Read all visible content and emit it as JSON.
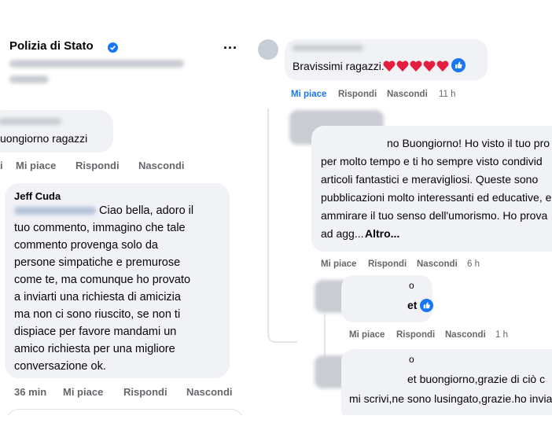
{
  "left": {
    "page_name": "Polizia di Stato",
    "dots_label": "...",
    "first_comment": {
      "text": "uongiorno ragazzi",
      "actions": [
        "Mi piace",
        "Rispondi",
        "Nascondi"
      ],
      "leading_char": "i"
    },
    "reply": {
      "author": "Jeff Cuda",
      "lines": [
        "Ciao bella, adoro il",
        "tuo commento, immagino che tale",
        "commento provenga solo da",
        "persone simpatiche e premurose",
        "come te, ma comunque ho provato",
        "a inviarti una richiesta di amicizia",
        "ma non ci sono riuscito, se non ti",
        "dispiace per favore mandami un",
        "amico  richiesta per una migliore",
        "conversazione ok."
      ],
      "time": "36 min",
      "actions": [
        "Mi piace",
        "Rispondi",
        "Nascondi"
      ]
    }
  },
  "right": {
    "top_comment": {
      "text": "Bravissimi ragazzi.",
      "hearts_count": 5,
      "actions": [
        "Mi piace",
        "Rispondi",
        "Nascondi"
      ],
      "time": "11 h"
    },
    "long_comment": {
      "lines": [
        "no Buongiorno! Ho visto il tuo pro",
        "per molto tempo e ti ho sempre visto condivid",
        "articoli fantastici e meravigliosi. Queste sono",
        "pubblicazioni molto interessanti ed educative, e",
        "ammirare il tuo senso dell'umorismo. Ho prova",
        "ad agg..."
      ],
      "more_label": "Altro...",
      "actions": [
        "Mi piace",
        "Rispondi",
        "Nascondi"
      ],
      "time": "6 h"
    },
    "short_reply": {
      "initial": "o",
      "text": "et",
      "actions": [
        "Mi piace",
        "Rispondi",
        "Nascondi"
      ],
      "time": "1 h"
    },
    "last_reply": {
      "initial": "o",
      "line1": "et buongiorno,grazie di ciò c",
      "line2": "mi scrivi,ne sono lusingato,grazie.ho invia"
    }
  },
  "colors": {
    "link_gray": "#65676b",
    "bubble": "#f0f2f5",
    "verified_blue": "#1877f2",
    "heart_red": "#e41e3f"
  }
}
